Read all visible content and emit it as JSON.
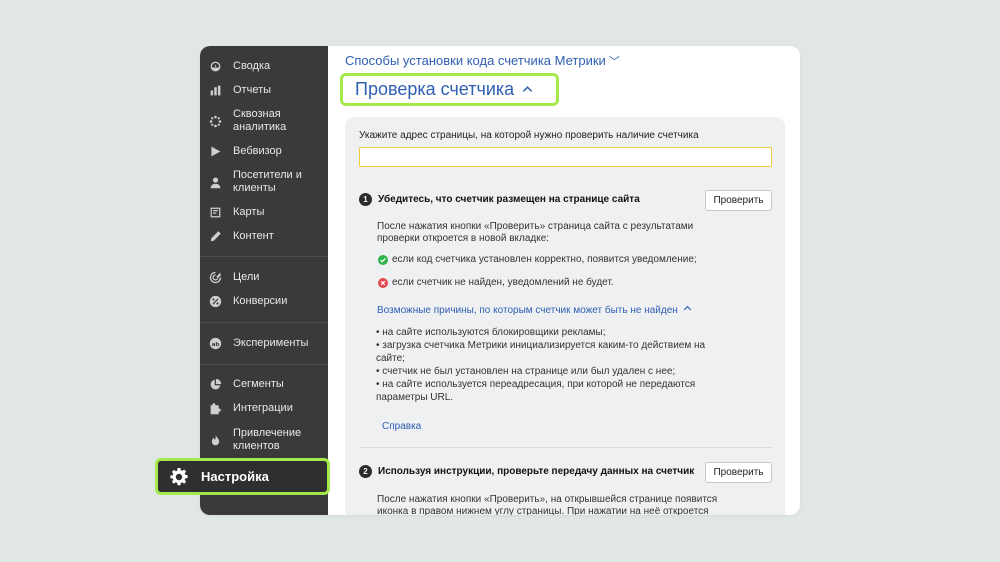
{
  "sidebar": {
    "items": [
      {
        "label": "Сводка",
        "icon": "gauge-icon"
      },
      {
        "label": "Отчеты",
        "icon": "bar-chart-icon"
      },
      {
        "label": "Сквозная аналитика",
        "icon": "asterisk-icon"
      },
      {
        "label": "Вебвизор",
        "icon": "play-icon"
      },
      {
        "label": "Посетители и клиенты",
        "icon": "person-icon"
      },
      {
        "label": "Карты",
        "icon": "map-icon"
      },
      {
        "label": "Контент",
        "icon": "pencil-icon"
      },
      {
        "label": "Цели",
        "icon": "target-icon"
      },
      {
        "label": "Конверсии",
        "icon": "percent-icon"
      },
      {
        "label": "Эксперименты",
        "icon": "ab-icon"
      },
      {
        "label": "Сегменты",
        "icon": "pie-icon"
      },
      {
        "label": "Интеграции",
        "icon": "puzzle-icon"
      },
      {
        "label": "Привлечение клиентов",
        "icon": "flame-icon"
      }
    ],
    "settings_label": "Настройка"
  },
  "main": {
    "top_link": "Способы установки кода счетчика Метрики",
    "heading": "Проверка счетчика",
    "address_label": "Укажите адрес страницы, на которой нужно проверить наличие счетчика",
    "address_value": "",
    "step1": {
      "number": "1",
      "title": "Убедитесь, что счетчик размещен на странице сайта",
      "button": "Проверить",
      "text_line1": "После нажатия кнопки «Проверить» страница сайта с результатами",
      "text_line2": "проверки откроется в новой вкладке:",
      "success": "если код счетчика установлен корректно, появится уведомление;",
      "fail": "если счетчик не найден, уведомлений не будет.",
      "reasons_link": "Возможные причины, по которым счетчик может быть не найден",
      "reasons": [
        "• на сайте используются блокировщики рекламы;",
        "• загрузка счетчика Метрики инициализируется каким-то действием на",
        "сайте;",
        "• счетчик не был установлен на странице или был удален с нее;",
        "• на сайте используется переадресация, при которой не передаются",
        "параметры URL."
      ],
      "help_link": "Справка"
    },
    "step2": {
      "number": "2",
      "title": "Используя инструкции, проверьте передачу данных на счетчик",
      "button": "Проверить",
      "text_line1": "После нажатия кнопки «Проверить», на открывшейся странице появится",
      "text_line2": "иконка в правом нижнем углу страницы. При нажатии на неё откроется"
    }
  },
  "colors": {
    "accent_highlight": "#a4e84c",
    "link_blue": "#2f5fb3",
    "sidebar_bg": "#3a3a3a",
    "success_green": "#2db34a",
    "error_red": "#e5484d"
  }
}
